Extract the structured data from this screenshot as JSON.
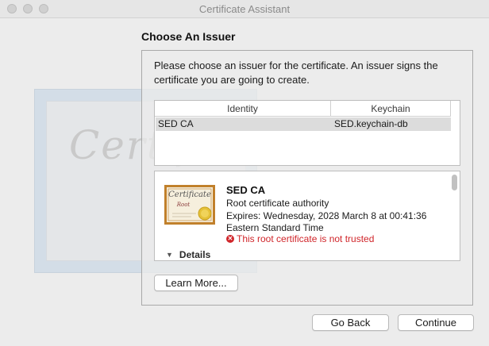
{
  "window": {
    "title": "Certificate Assistant"
  },
  "page": {
    "heading": "Choose An Issuer",
    "description": "Please choose an issuer for the certificate. An issuer signs the certificate you are going to create."
  },
  "issuer_table": {
    "columns": [
      "Identity",
      "Keychain"
    ],
    "rows": [
      {
        "identity": "SED CA",
        "keychain": "SED.keychain-db"
      }
    ]
  },
  "certificate": {
    "name": "SED CA",
    "type": "Root certificate authority",
    "expires": "Expires: Wednesday, 2028 March 8 at 00:41:36",
    "timezone": "Eastern Standard Time",
    "warning": "This root certificate is not trusted",
    "details_label": "Details",
    "icon_title": "Certificate",
    "icon_sub": "Root"
  },
  "background": {
    "watermark": "Certif"
  },
  "buttons": {
    "learn_more": "Learn More...",
    "go_back": "Go Back",
    "continue": "Continue"
  },
  "colors": {
    "warning": "#d0252a",
    "selection": "#dcdcdc"
  }
}
